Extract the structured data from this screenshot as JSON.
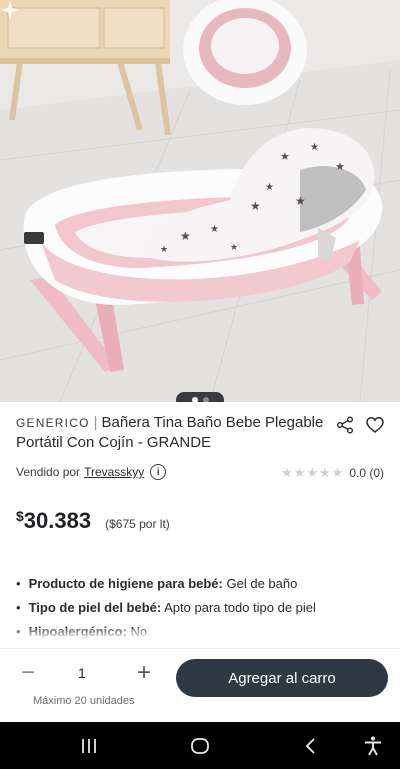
{
  "image": {
    "alt_subject": "pink folding baby bathtub with star-print cushion",
    "colors": {
      "tub_pink": "#f1c6cc",
      "tub_white": "#fbfbfb",
      "floor": "#e8e6e5",
      "cushion": "#f5f3f4",
      "star": "#5a4c55"
    },
    "pager": {
      "count": 2,
      "active_index": 0
    }
  },
  "product": {
    "brand": "GENERICO",
    "separator": "|",
    "title": "Bañera Tina Baño Bebe Plegable Portátil Con Cojín - GRANDE"
  },
  "seller": {
    "prefix": "Vendido por",
    "name": "Trevasskyy",
    "info_icon": "i"
  },
  "rating": {
    "stars_filled": 0,
    "stars_total": 5,
    "score_text": "0.0 (0)"
  },
  "price": {
    "currency": "$",
    "amount": "30.383",
    "unit_price": "($675 por lt)"
  },
  "attributes": [
    {
      "label": "Producto de higiene para bebé:",
      "value": "Gel de baño"
    },
    {
      "label": "Tipo de piel del bebé:",
      "value": "Apto para todo tipo de piel"
    },
    {
      "label": "Hipoalergénico:",
      "value": "No"
    }
  ],
  "purchase": {
    "minus": "−",
    "plus": "+",
    "quantity": "1",
    "max_note": "Máximo 20 unidades",
    "cart_button": "Agregar al carro"
  },
  "icons": {
    "share": "share-icon",
    "favorite": "heart-icon",
    "nav_recent": "recent-apps-icon",
    "nav_home": "home-icon",
    "nav_back": "back-icon",
    "nav_accessibility": "accessibility-icon"
  },
  "colors": {
    "primary_button": "#2f3944",
    "text": "#1f2023",
    "muted": "#6b6c70",
    "nav_bar": "#000000"
  }
}
